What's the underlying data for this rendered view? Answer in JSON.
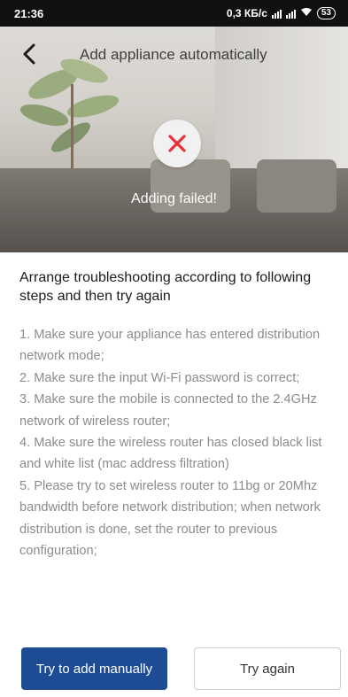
{
  "status_bar": {
    "time": "21:36",
    "network_speed": "0,3 КБ/с",
    "battery": "53"
  },
  "header": {
    "title": "Add appliance automatically"
  },
  "result": {
    "message": "Adding failed!"
  },
  "content": {
    "heading": "Arrange troubleshooting according to following steps and then try again",
    "steps": [
      "1. Make sure your appliance has entered distribution network mode;",
      "2. Make sure the input Wi-Fi password is correct;",
      "3. Make sure the mobile is connected to the 2.4GHz network of wireless router;",
      "4. Make sure the wireless router has closed black list and white list (mac address filtration)",
      "5. Please try to set wireless router to 11bg or 20Mhz bandwidth before network distribution; when network distribution is done, set the router to previous configuration;"
    ]
  },
  "actions": {
    "manual_label": "Try to add manually",
    "retry_label": "Try again"
  },
  "colors": {
    "primary": "#1d4c95",
    "error": "#e8303a"
  }
}
